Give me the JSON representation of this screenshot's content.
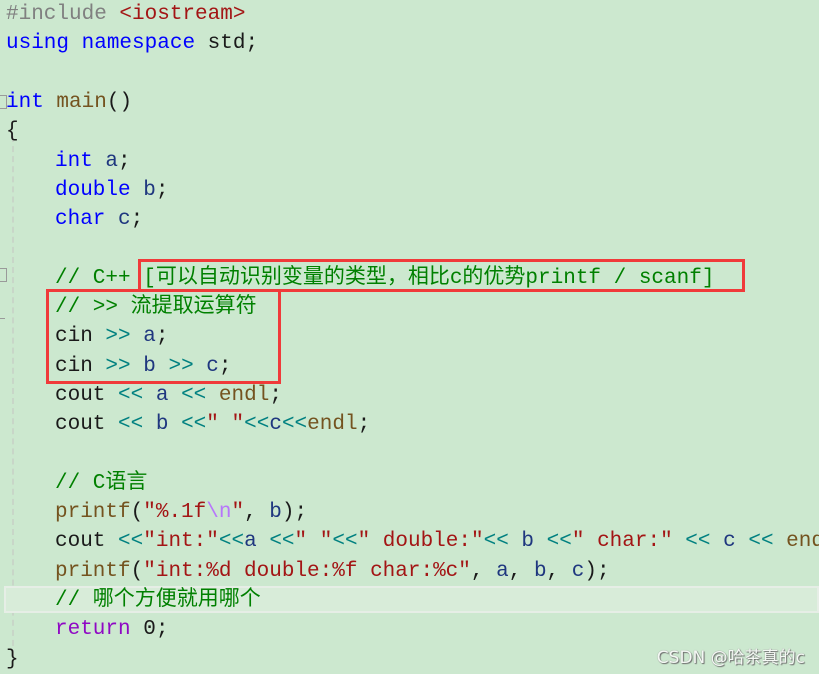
{
  "editor": {
    "language": "C++",
    "lines": [
      {
        "tokens": [
          {
            "t": "#include ",
            "c": "pp"
          },
          {
            "t": "<iostream>",
            "c": "inc"
          }
        ]
      },
      {
        "tokens": [
          {
            "t": "using",
            "c": "kw"
          },
          {
            "t": " "
          },
          {
            "t": "namespace",
            "c": "kw"
          },
          {
            "t": " std;",
            "c": "id"
          }
        ]
      },
      {
        "tokens": []
      },
      {
        "tokens": [
          {
            "t": "int",
            "c": "kw"
          },
          {
            "t": " "
          },
          {
            "t": "main",
            "c": "fn"
          },
          {
            "t": "()",
            "c": "id"
          }
        ]
      },
      {
        "tokens": [
          {
            "t": "{",
            "c": "id"
          }
        ]
      },
      {
        "indent": true,
        "tokens": [
          {
            "t": "int",
            "c": "kw"
          },
          {
            "t": " "
          },
          {
            "t": "a",
            "c": "var"
          },
          {
            "t": ";",
            "c": "id"
          }
        ]
      },
      {
        "indent": true,
        "tokens": [
          {
            "t": "double",
            "c": "kw"
          },
          {
            "t": " "
          },
          {
            "t": "b",
            "c": "var"
          },
          {
            "t": ";",
            "c": "id"
          }
        ]
      },
      {
        "indent": true,
        "tokens": [
          {
            "t": "char",
            "c": "kw"
          },
          {
            "t": " "
          },
          {
            "t": "c",
            "c": "var"
          },
          {
            "t": ";",
            "c": "id"
          }
        ]
      },
      {
        "tokens": []
      },
      {
        "indent": true,
        "tokens": [
          {
            "t": "// C++ [可以自动识别变量的类型，相比c的优势printf / scanf]",
            "c": "cm"
          }
        ]
      },
      {
        "indent": true,
        "tokens": [
          {
            "t": "// >> 流提取运算符",
            "c": "cm"
          }
        ]
      },
      {
        "indent": true,
        "tokens": [
          {
            "t": "cin",
            "c": "id"
          },
          {
            "t": " "
          },
          {
            "t": ">>",
            "c": "op"
          },
          {
            "t": " "
          },
          {
            "t": "a",
            "c": "var"
          },
          {
            "t": ";",
            "c": "id"
          }
        ]
      },
      {
        "indent": true,
        "tokens": [
          {
            "t": "cin",
            "c": "id"
          },
          {
            "t": " "
          },
          {
            "t": ">>",
            "c": "op"
          },
          {
            "t": " "
          },
          {
            "t": "b",
            "c": "var"
          },
          {
            "t": " "
          },
          {
            "t": ">>",
            "c": "op"
          },
          {
            "t": " "
          },
          {
            "t": "c",
            "c": "var"
          },
          {
            "t": ";",
            "c": "id"
          }
        ]
      },
      {
        "indent": true,
        "tokens": [
          {
            "t": "cout",
            "c": "id"
          },
          {
            "t": " "
          },
          {
            "t": "<<",
            "c": "op"
          },
          {
            "t": " "
          },
          {
            "t": "a",
            "c": "var"
          },
          {
            "t": " "
          },
          {
            "t": "<<",
            "c": "op"
          },
          {
            "t": " "
          },
          {
            "t": "endl",
            "c": "fn"
          },
          {
            "t": ";",
            "c": "id"
          }
        ]
      },
      {
        "indent": true,
        "tokens": [
          {
            "t": "cout",
            "c": "id"
          },
          {
            "t": " "
          },
          {
            "t": "<<",
            "c": "op"
          },
          {
            "t": " "
          },
          {
            "t": "b",
            "c": "var"
          },
          {
            "t": " "
          },
          {
            "t": "<<",
            "c": "op"
          },
          {
            "t": "\" \"",
            "c": "str"
          },
          {
            "t": "<<",
            "c": "op"
          },
          {
            "t": "c",
            "c": "var"
          },
          {
            "t": "<<",
            "c": "op"
          },
          {
            "t": "endl",
            "c": "fn"
          },
          {
            "t": ";",
            "c": "id"
          }
        ]
      },
      {
        "tokens": []
      },
      {
        "indent": true,
        "tokens": [
          {
            "t": "// C语言",
            "c": "cm"
          }
        ]
      },
      {
        "indent": true,
        "tokens": [
          {
            "t": "printf",
            "c": "fn"
          },
          {
            "t": "(",
            "c": "id"
          },
          {
            "t": "\"%.1f",
            "c": "str"
          },
          {
            "t": "\\n",
            "c": "esc"
          },
          {
            "t": "\"",
            "c": "str"
          },
          {
            "t": ", ",
            "c": "id"
          },
          {
            "t": "b",
            "c": "var"
          },
          {
            "t": ");",
            "c": "id"
          }
        ]
      },
      {
        "indent": true,
        "tokens": [
          {
            "t": "cout",
            "c": "id"
          },
          {
            "t": " "
          },
          {
            "t": "<<",
            "c": "op"
          },
          {
            "t": "\"int:\"",
            "c": "str"
          },
          {
            "t": "<<",
            "c": "op"
          },
          {
            "t": "a",
            "c": "var"
          },
          {
            "t": " "
          },
          {
            "t": "<<",
            "c": "op"
          },
          {
            "t": "\" \"",
            "c": "str"
          },
          {
            "t": "<<",
            "c": "op"
          },
          {
            "t": "\" double:\"",
            "c": "str"
          },
          {
            "t": "<<",
            "c": "op"
          },
          {
            "t": " "
          },
          {
            "t": "b",
            "c": "var"
          },
          {
            "t": " "
          },
          {
            "t": "<<",
            "c": "op"
          },
          {
            "t": "\" char:\"",
            "c": "str"
          },
          {
            "t": " "
          },
          {
            "t": "<<",
            "c": "op"
          },
          {
            "t": " "
          },
          {
            "t": "c",
            "c": "var"
          },
          {
            "t": " "
          },
          {
            "t": "<<",
            "c": "op"
          },
          {
            "t": " "
          },
          {
            "t": "endl",
            "c": "fn"
          },
          {
            "t": ";",
            "c": "id"
          }
        ]
      },
      {
        "indent": true,
        "tokens": [
          {
            "t": "printf",
            "c": "fn"
          },
          {
            "t": "(",
            "c": "id"
          },
          {
            "t": "\"int:%d double:%f char:%c\"",
            "c": "str"
          },
          {
            "t": ", ",
            "c": "id"
          },
          {
            "t": "a",
            "c": "var"
          },
          {
            "t": ", ",
            "c": "id"
          },
          {
            "t": "b",
            "c": "var"
          },
          {
            "t": ", ",
            "c": "id"
          },
          {
            "t": "c",
            "c": "var"
          },
          {
            "t": ");",
            "c": "id"
          }
        ]
      },
      {
        "indent": true,
        "tokens": [
          {
            "t": "// 哪个方便就用哪个",
            "c": "cm"
          }
        ]
      },
      {
        "indent": true,
        "tokens": [
          {
            "t": "return",
            "c": "ret"
          },
          {
            "t": " "
          },
          {
            "t": "0",
            "c": "num"
          },
          {
            "t": ";",
            "c": "id"
          }
        ]
      },
      {
        "tokens": [
          {
            "t": "}",
            "c": "id"
          }
        ]
      }
    ],
    "current_line_index": 20
  },
  "annotations": {
    "box1_label": "highlight-cpp-advantage-comment",
    "box2_label": "highlight-cin-extraction"
  },
  "watermark": "CSDN @哈茶真的c",
  "colors": {
    "background": "#cce8cf",
    "keyword": "#0000ff",
    "comment": "#008000",
    "string": "#a31515",
    "highlight_box": "#f03a3a"
  }
}
